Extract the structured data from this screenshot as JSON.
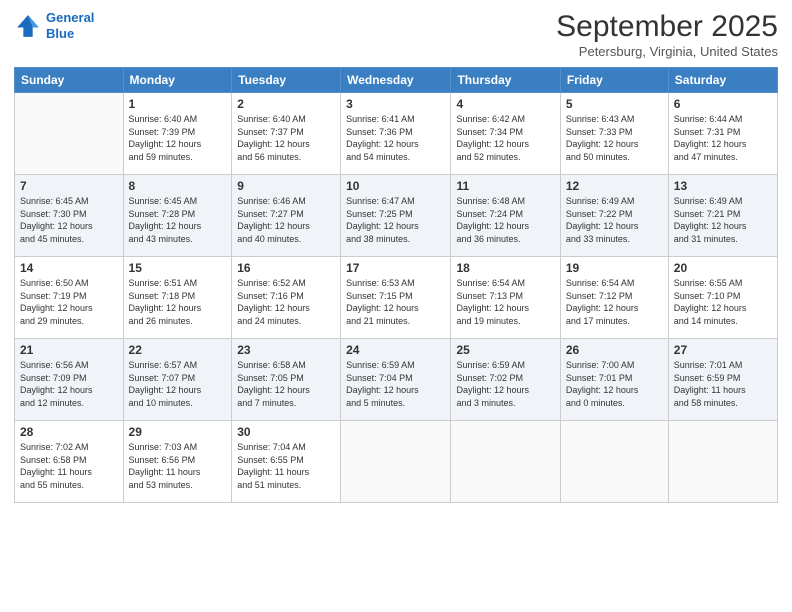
{
  "logo": {
    "line1": "General",
    "line2": "Blue"
  },
  "title": "September 2025",
  "location": "Petersburg, Virginia, United States",
  "weekdays": [
    "Sunday",
    "Monday",
    "Tuesday",
    "Wednesday",
    "Thursday",
    "Friday",
    "Saturday"
  ],
  "weeks": [
    [
      {
        "day": "",
        "info": ""
      },
      {
        "day": "1",
        "info": "Sunrise: 6:40 AM\nSunset: 7:39 PM\nDaylight: 12 hours\nand 59 minutes."
      },
      {
        "day": "2",
        "info": "Sunrise: 6:40 AM\nSunset: 7:37 PM\nDaylight: 12 hours\nand 56 minutes."
      },
      {
        "day": "3",
        "info": "Sunrise: 6:41 AM\nSunset: 7:36 PM\nDaylight: 12 hours\nand 54 minutes."
      },
      {
        "day": "4",
        "info": "Sunrise: 6:42 AM\nSunset: 7:34 PM\nDaylight: 12 hours\nand 52 minutes."
      },
      {
        "day": "5",
        "info": "Sunrise: 6:43 AM\nSunset: 7:33 PM\nDaylight: 12 hours\nand 50 minutes."
      },
      {
        "day": "6",
        "info": "Sunrise: 6:44 AM\nSunset: 7:31 PM\nDaylight: 12 hours\nand 47 minutes."
      }
    ],
    [
      {
        "day": "7",
        "info": "Sunrise: 6:45 AM\nSunset: 7:30 PM\nDaylight: 12 hours\nand 45 minutes."
      },
      {
        "day": "8",
        "info": "Sunrise: 6:45 AM\nSunset: 7:28 PM\nDaylight: 12 hours\nand 43 minutes."
      },
      {
        "day": "9",
        "info": "Sunrise: 6:46 AM\nSunset: 7:27 PM\nDaylight: 12 hours\nand 40 minutes."
      },
      {
        "day": "10",
        "info": "Sunrise: 6:47 AM\nSunset: 7:25 PM\nDaylight: 12 hours\nand 38 minutes."
      },
      {
        "day": "11",
        "info": "Sunrise: 6:48 AM\nSunset: 7:24 PM\nDaylight: 12 hours\nand 36 minutes."
      },
      {
        "day": "12",
        "info": "Sunrise: 6:49 AM\nSunset: 7:22 PM\nDaylight: 12 hours\nand 33 minutes."
      },
      {
        "day": "13",
        "info": "Sunrise: 6:49 AM\nSunset: 7:21 PM\nDaylight: 12 hours\nand 31 minutes."
      }
    ],
    [
      {
        "day": "14",
        "info": "Sunrise: 6:50 AM\nSunset: 7:19 PM\nDaylight: 12 hours\nand 29 minutes."
      },
      {
        "day": "15",
        "info": "Sunrise: 6:51 AM\nSunset: 7:18 PM\nDaylight: 12 hours\nand 26 minutes."
      },
      {
        "day": "16",
        "info": "Sunrise: 6:52 AM\nSunset: 7:16 PM\nDaylight: 12 hours\nand 24 minutes."
      },
      {
        "day": "17",
        "info": "Sunrise: 6:53 AM\nSunset: 7:15 PM\nDaylight: 12 hours\nand 21 minutes."
      },
      {
        "day": "18",
        "info": "Sunrise: 6:54 AM\nSunset: 7:13 PM\nDaylight: 12 hours\nand 19 minutes."
      },
      {
        "day": "19",
        "info": "Sunrise: 6:54 AM\nSunset: 7:12 PM\nDaylight: 12 hours\nand 17 minutes."
      },
      {
        "day": "20",
        "info": "Sunrise: 6:55 AM\nSunset: 7:10 PM\nDaylight: 12 hours\nand 14 minutes."
      }
    ],
    [
      {
        "day": "21",
        "info": "Sunrise: 6:56 AM\nSunset: 7:09 PM\nDaylight: 12 hours\nand 12 minutes."
      },
      {
        "day": "22",
        "info": "Sunrise: 6:57 AM\nSunset: 7:07 PM\nDaylight: 12 hours\nand 10 minutes."
      },
      {
        "day": "23",
        "info": "Sunrise: 6:58 AM\nSunset: 7:05 PM\nDaylight: 12 hours\nand 7 minutes."
      },
      {
        "day": "24",
        "info": "Sunrise: 6:59 AM\nSunset: 7:04 PM\nDaylight: 12 hours\nand 5 minutes."
      },
      {
        "day": "25",
        "info": "Sunrise: 6:59 AM\nSunset: 7:02 PM\nDaylight: 12 hours\nand 3 minutes."
      },
      {
        "day": "26",
        "info": "Sunrise: 7:00 AM\nSunset: 7:01 PM\nDaylight: 12 hours\nand 0 minutes."
      },
      {
        "day": "27",
        "info": "Sunrise: 7:01 AM\nSunset: 6:59 PM\nDaylight: 11 hours\nand 58 minutes."
      }
    ],
    [
      {
        "day": "28",
        "info": "Sunrise: 7:02 AM\nSunset: 6:58 PM\nDaylight: 11 hours\nand 55 minutes."
      },
      {
        "day": "29",
        "info": "Sunrise: 7:03 AM\nSunset: 6:56 PM\nDaylight: 11 hours\nand 53 minutes."
      },
      {
        "day": "30",
        "info": "Sunrise: 7:04 AM\nSunset: 6:55 PM\nDaylight: 11 hours\nand 51 minutes."
      },
      {
        "day": "",
        "info": ""
      },
      {
        "day": "",
        "info": ""
      },
      {
        "day": "",
        "info": ""
      },
      {
        "day": "",
        "info": ""
      }
    ]
  ]
}
